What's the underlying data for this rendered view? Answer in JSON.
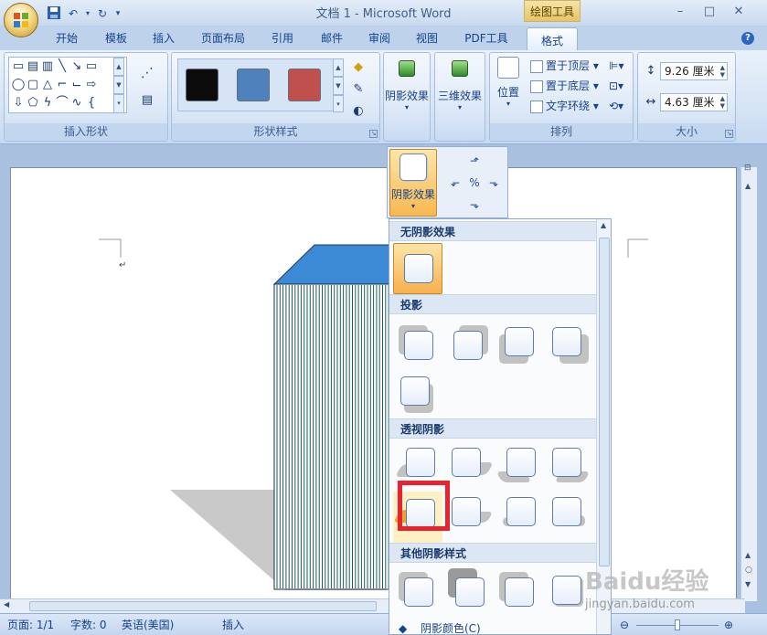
{
  "window": {
    "title": "文档 1 - Microsoft Word",
    "contextual_tab_group": "绘图工具",
    "buttons": {
      "minimize": "–",
      "maximize": "□",
      "close": "✕"
    }
  },
  "quick_access": {
    "save": "save-icon",
    "undo": "undo-icon",
    "redo": "redo-icon",
    "more": "▾"
  },
  "tabs": [
    "开始",
    "模板",
    "插入",
    "页面布局",
    "引用",
    "邮件",
    "审阅",
    "视图",
    "PDF工具",
    "格式"
  ],
  "active_tab": "格式",
  "ribbon": {
    "insert_shapes": {
      "label": "插入形状"
    },
    "shape_styles": {
      "label": "形状样式",
      "swatches": [
        "#0c0c0c",
        "#4f81bd",
        "#c0504d"
      ]
    },
    "shadow_effects": {
      "label": "阴影效果"
    },
    "three_d_effects": {
      "label": "三维效果"
    },
    "arrange": {
      "label": "排列",
      "position": "位置",
      "bring_front": "置于顶层",
      "send_back": "置于底层",
      "text_wrap": "文字环绕"
    },
    "size": {
      "label": "大小",
      "height": "9.26 厘米",
      "width": "4.63 厘米"
    }
  },
  "popup": {
    "shadow_button": "阴影效果"
  },
  "shadow_menu": {
    "sections": {
      "none": "无阴影效果",
      "drop": "投影",
      "perspective": "透视阴影",
      "other": "其他阴影样式"
    },
    "bottom_item": "阴影颜色(C)"
  },
  "document": {
    "paragraph_mark": "↵"
  },
  "status": {
    "page": "页面: 1/1",
    "words": "字数: 0",
    "language": "英语(美国)",
    "mode": "插入"
  },
  "watermark": {
    "brand": "Baidu经验",
    "url": "jingyan.baidu.com"
  }
}
